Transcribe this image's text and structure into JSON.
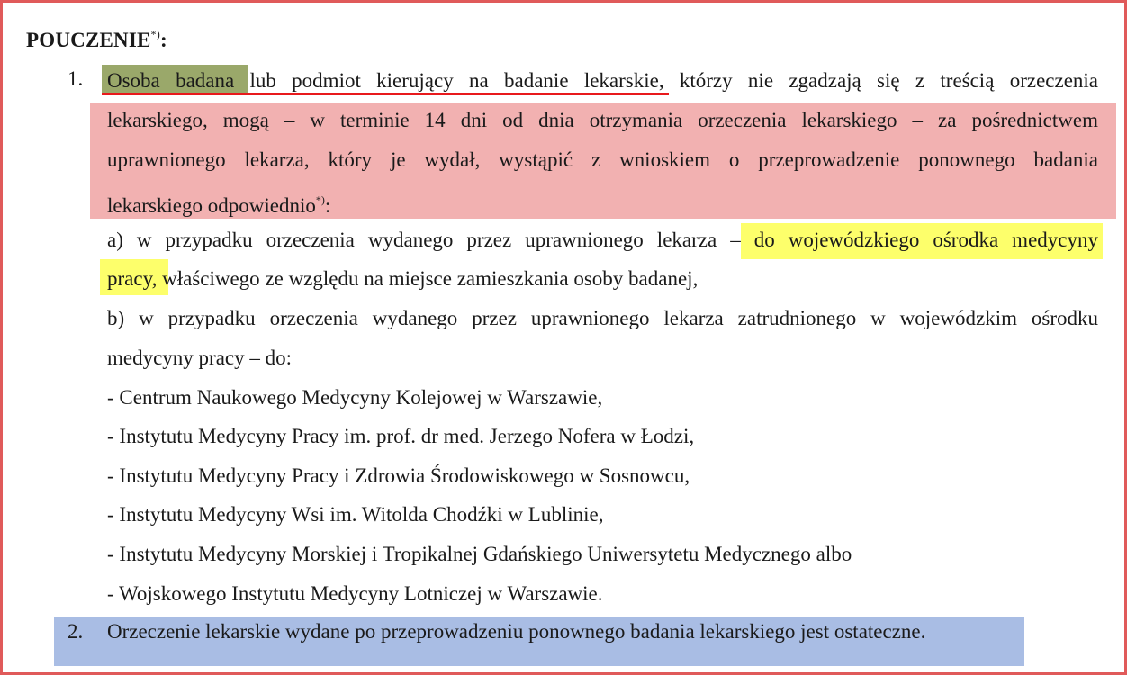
{
  "document": {
    "title": "POUCZENIE",
    "title_sup": "*)",
    "title_colon": ":",
    "items": [
      {
        "number": "1.",
        "line1_highlight": "Osoba badana",
        "line1_rest": "lub podmiot kierujący na badanie lekarskie, którzy nie zgadzają się z treścią orzeczenia",
        "line2": "lekarskiego, mogą – w terminie 14 dni od dnia otrzymania orzeczenia lekarskiego – za pośrednictwem",
        "line3": "uprawnionego lekarza, który je wydał, wystąpić z wnioskiem o  przeprowadzenie ponownego badania",
        "line4": "lekarskiego odpowiednio",
        "line4_sup": "*)",
        "line4_end": ":",
        "a_line1": "a) w przypadku orzeczenia wydanego przez uprawnionego lekarza – do wojewódzkiego ośrodka medycyny",
        "a_line2": "pracy, właściwego ze względu na miejsce zamieszkania osoby badanej,",
        "b_line1": "b) w przypadku orzeczenia wydanego przez uprawnionego lekarza zatrudnionego w wojewódzkim ośrodku",
        "b_line2": "medycyny pracy – do:",
        "institutes": [
          "- Centrum Naukowego Medycyny Kolejowej w Warszawie,",
          "- Instytutu Medycyny Pracy im. prof. dr med. Jerzego Nofera w Łodzi,",
          "- Instytutu Medycyny Pracy i Zdrowia Środowiskowego w Sosnowcu,",
          "- Instytutu Medycyny Wsi im. Witolda Chodźki w Lublinie,",
          "- Instytutu Medycyny Morskiej i Tropikalnej Gdańskiego Uniwersytetu Medycznego albo",
          "- Wojskowego Instytutu Medycyny Lotniczej w Warszawie."
        ]
      },
      {
        "number": "2.",
        "text": "Orzeczenie lekarskie wydane po przeprowadzeniu ponownego badania lekarskiego jest ostateczne."
      }
    ]
  },
  "highlight_colors": {
    "green": "#9aa86a",
    "red_underline": "#e8191c",
    "pink": "#f2b1b1",
    "yellow": "#fdff6b",
    "blue": "#a9bde4",
    "frame": "#e05a5a"
  }
}
